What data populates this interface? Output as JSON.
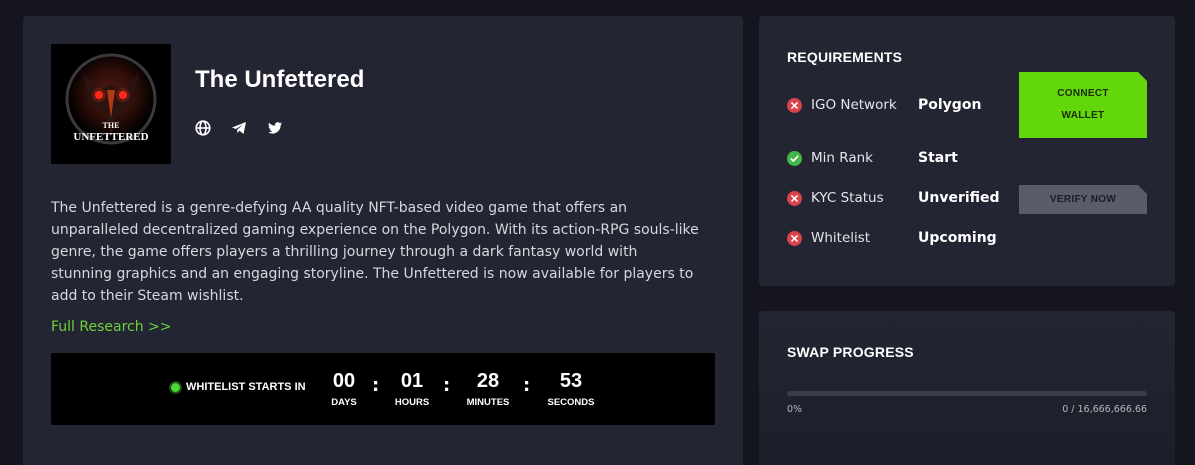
{
  "project": {
    "title": "The Unfettered",
    "logo_text_1": "THE",
    "logo_text_2": "UNFETTERED",
    "social": [
      "globe-icon",
      "telegram-icon",
      "twitter-icon"
    ],
    "description": "The Unfettered is a genre-defying AA quality NFT-based video game that offers an unparalleled decentralized gaming experience on the Polygon. With its action-RPG souls-like genre, the game offers players a thrilling journey through a dark fantasy world with stunning graphics and an engaging storyline. The Unfettered is now available for players to add to their Steam wishlist.",
    "research_link": "Full Research >>"
  },
  "timer": {
    "label": "WHITELIST STARTS IN",
    "days": "00",
    "hours": "01",
    "minutes": "28",
    "seconds": "53",
    "days_label": "DAYS",
    "hours_label": "HOURS",
    "minutes_label": "MINUTES",
    "seconds_label": "SECONDS",
    "separator": ":"
  },
  "requirements": {
    "title": "REQUIREMENTS",
    "rows": [
      {
        "name": "IGO Network",
        "value": "Polygon",
        "status": "fail"
      },
      {
        "name": "Min Rank",
        "value": "Start",
        "status": "pass"
      },
      {
        "name": "KYC Status",
        "value": "Unverified",
        "status": "fail"
      },
      {
        "name": "Whitelist",
        "value": "Upcoming",
        "status": "fail"
      }
    ],
    "connect_button_line1": "CONNECT",
    "connect_button_line2": "WALLET",
    "verify_button": "VERIFY NOW"
  },
  "swap": {
    "title": "SWAP PROGRESS",
    "percent_label": "0%",
    "progress_fraction": 0,
    "amount_label": "0 / 16,666,666.66"
  },
  "colors": {
    "accent": "#62d70c",
    "fail": "#d9434a",
    "pass": "#43b649",
    "panel": "#232532",
    "background": "#14151f"
  }
}
